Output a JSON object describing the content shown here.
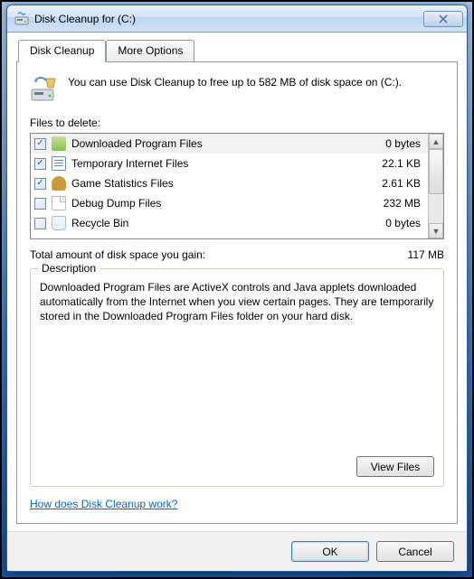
{
  "window": {
    "title": "Disk Cleanup for  (C:)"
  },
  "tabs": {
    "cleanup": "Disk Cleanup",
    "more": "More Options"
  },
  "intro": "You can use Disk Cleanup to free up to 582 MB of disk space on  (C:).",
  "files_label": "Files to delete:",
  "files": [
    {
      "checked": true,
      "icon": "folder-icon",
      "name": "Downloaded Program Files",
      "size": "0 bytes"
    },
    {
      "checked": true,
      "icon": "document-icon",
      "name": "Temporary Internet Files",
      "size": "22.1 KB"
    },
    {
      "checked": true,
      "icon": "chess-icon",
      "name": "Game Statistics Files",
      "size": "2.61 KB"
    },
    {
      "checked": false,
      "icon": "blank-icon",
      "name": "Debug Dump Files",
      "size": "232 MB"
    },
    {
      "checked": false,
      "icon": "recycle-icon",
      "name": "Recycle Bin",
      "size": "0 bytes"
    }
  ],
  "total": {
    "label": "Total amount of disk space you gain:",
    "value": "117 MB"
  },
  "description": {
    "title": "Description",
    "text": "Downloaded Program Files are ActiveX controls and Java applets downloaded automatically from the Internet when you view certain pages. They are temporarily stored in the Downloaded Program Files folder on your hard disk."
  },
  "buttons": {
    "view_files": "View Files",
    "ok": "OK",
    "cancel": "Cancel"
  },
  "help_link": "How does Disk Cleanup work?"
}
